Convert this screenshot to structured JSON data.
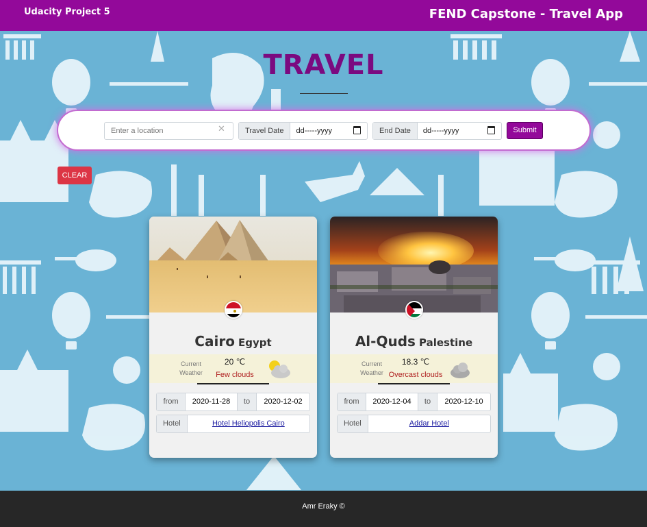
{
  "header": {
    "left_title": "Udacity Project 5",
    "right_title": "FEND Capstone - Travel App"
  },
  "page_title": "TRAVEL",
  "search": {
    "location_placeholder": "Enter a location",
    "clear_glyph": "✕",
    "travel_date_label": "Travel Date",
    "travel_date_value": "dd-----yyyy",
    "end_date_label": "End Date",
    "end_date_value": "dd-----yyyy",
    "submit_label": "Submit"
  },
  "clear_label": "CLEAR",
  "cards": [
    {
      "city": "Cairo",
      "country": "Egypt",
      "weather_label_1": "Current",
      "weather_label_2": "Weather",
      "temperature": "20 ℃",
      "description": "Few clouds",
      "weather_icon": "sun-cloud-icon",
      "from_label": "from",
      "from_date": "2020-11-28",
      "to_label": "to",
      "to_date": "2020-12-02",
      "hotel_label": "Hotel",
      "hotel_name": "Hotel Heliopolis Cairo"
    },
    {
      "city": "Al-Quds",
      "country": "Palestine",
      "weather_label_1": "Current",
      "weather_label_2": "Weather",
      "temperature": "18.3 ℃",
      "description": "Overcast clouds",
      "weather_icon": "cloud-icon",
      "from_label": "from",
      "from_date": "2020-12-04",
      "to_label": "to",
      "to_date": "2020-12-10",
      "hotel_label": "Hotel",
      "hotel_name": "Addar Hotel"
    }
  ],
  "footer": "Amr Eraky ©",
  "colors": {
    "brand_purple": "#93099a",
    "title_purple": "#7b0a80",
    "background_blue": "#6ab3d5",
    "clear_red": "#dc3545",
    "footer_dark": "#272727"
  }
}
